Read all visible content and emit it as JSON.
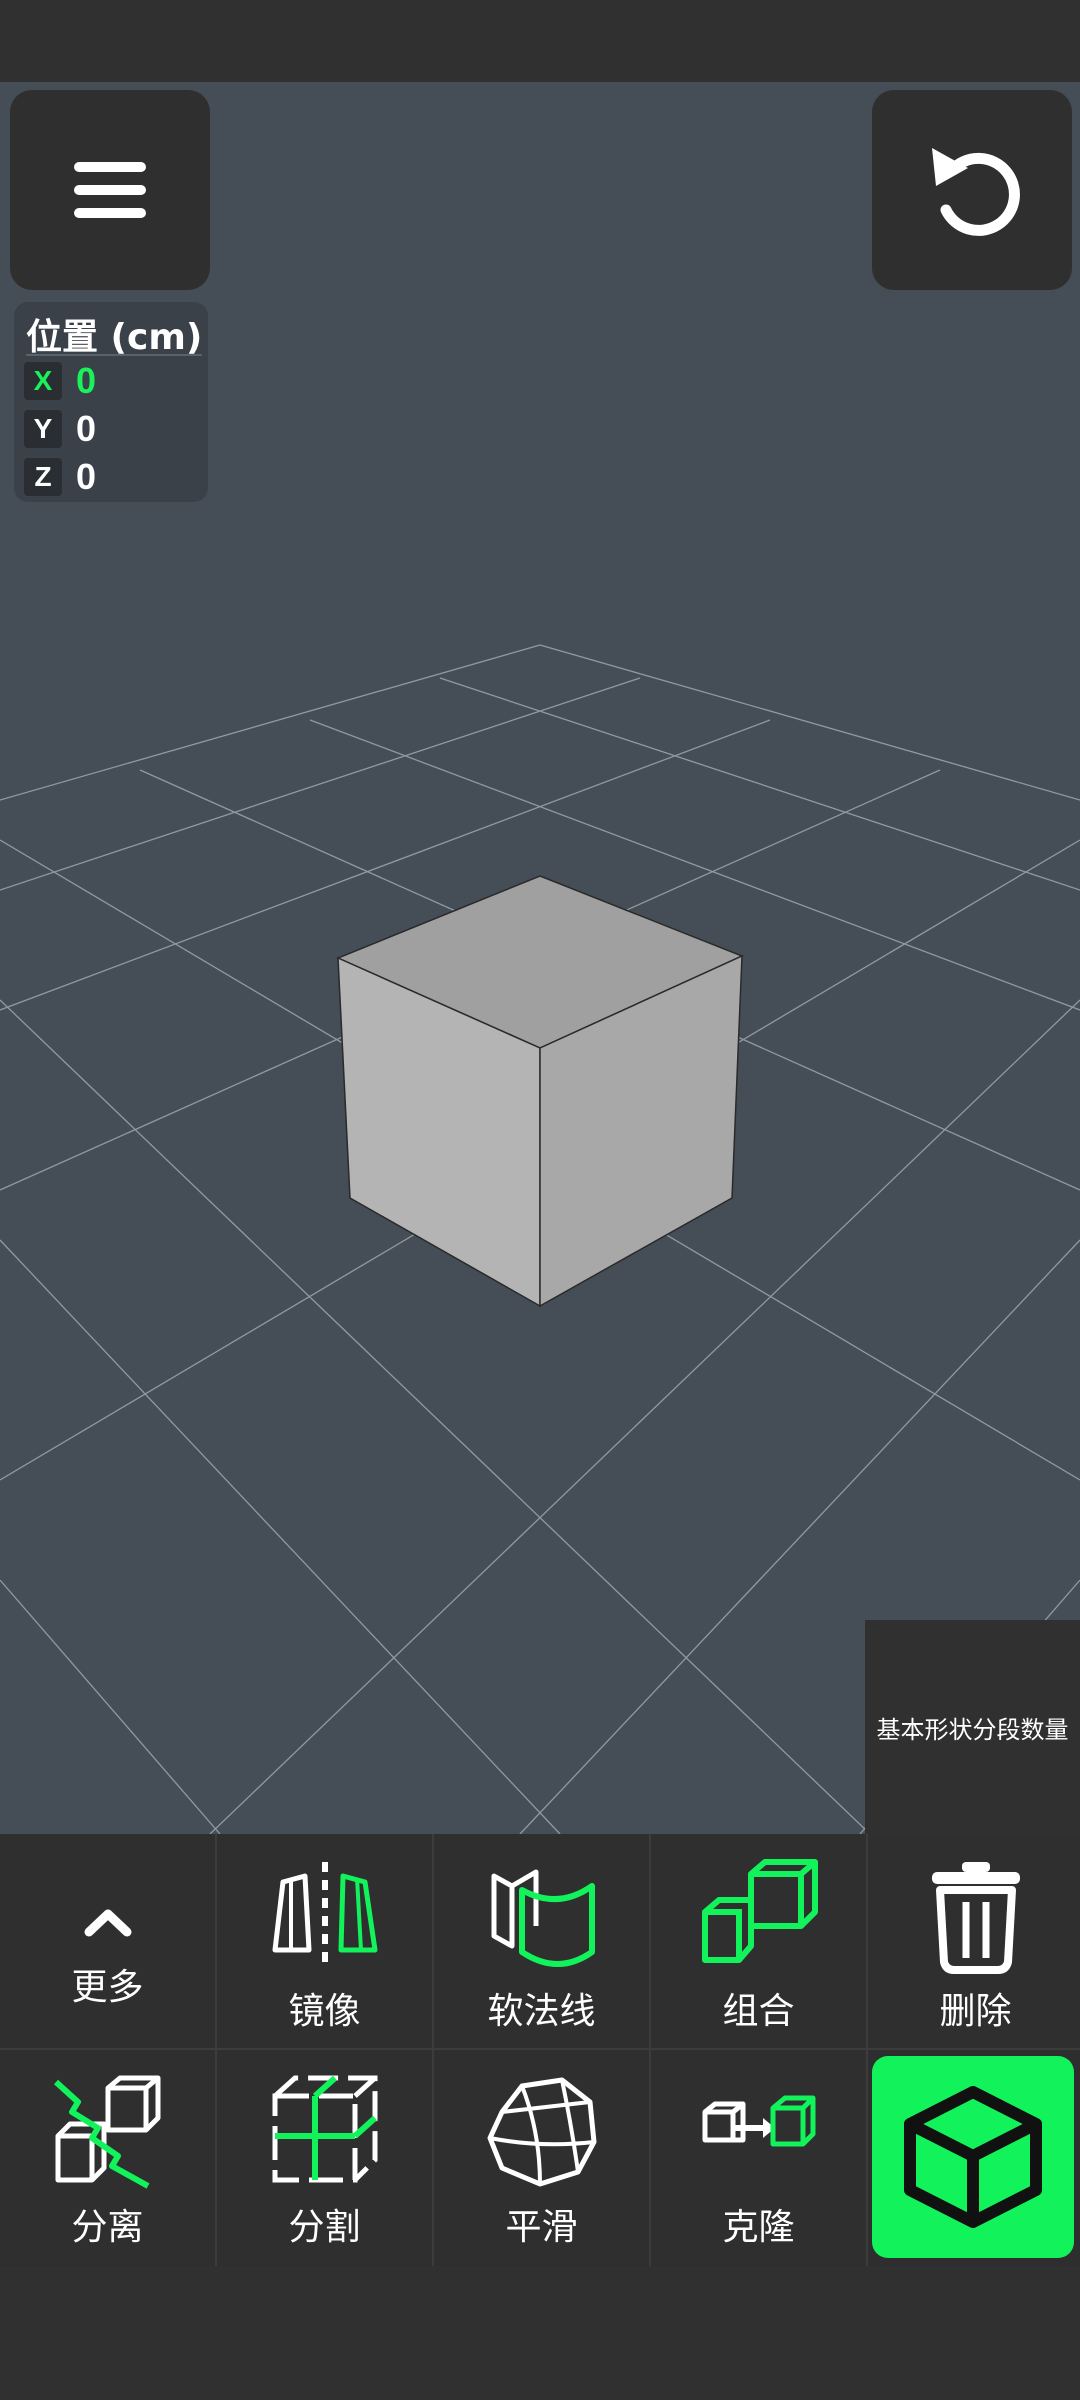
{
  "colors": {
    "accent": "#12f25a",
    "viewport_bg": "#454e57",
    "panel_bg": "#2f2f2f",
    "cube_top": "#a0a0a0",
    "cube_left": "#b4b4b4",
    "cube_right": "#a8a8a8"
  },
  "position_panel": {
    "title": "位置 (cm)",
    "axes": [
      {
        "axis": "X",
        "value": "0",
        "active": true
      },
      {
        "axis": "Y",
        "value": "0",
        "active": false
      },
      {
        "axis": "Z",
        "value": "0",
        "active": false
      }
    ]
  },
  "top_buttons": {
    "menu_icon": "hamburger-icon",
    "undo_icon": "undo-icon"
  },
  "segment_button": {
    "label": "基本形状分段数量"
  },
  "toolbar": {
    "row1": [
      {
        "id": "more",
        "label": "更多",
        "icon": "chevron-up-icon"
      },
      {
        "id": "mirror",
        "label": "镜像",
        "icon": "mirror-icon"
      },
      {
        "id": "soft-normals",
        "label": "软法线",
        "icon": "soft-normals-icon"
      },
      {
        "id": "group",
        "label": "组合",
        "icon": "group-icon"
      },
      {
        "id": "delete",
        "label": "删除",
        "icon": "trash-icon"
      }
    ],
    "row2": [
      {
        "id": "separate",
        "label": "分离",
        "icon": "separate-icon"
      },
      {
        "id": "split",
        "label": "分割",
        "icon": "split-icon"
      },
      {
        "id": "smooth",
        "label": "平滑",
        "icon": "smooth-icon"
      },
      {
        "id": "clone",
        "label": "克隆",
        "icon": "clone-icon"
      }
    ],
    "create_button_icon": "cube-icon"
  }
}
